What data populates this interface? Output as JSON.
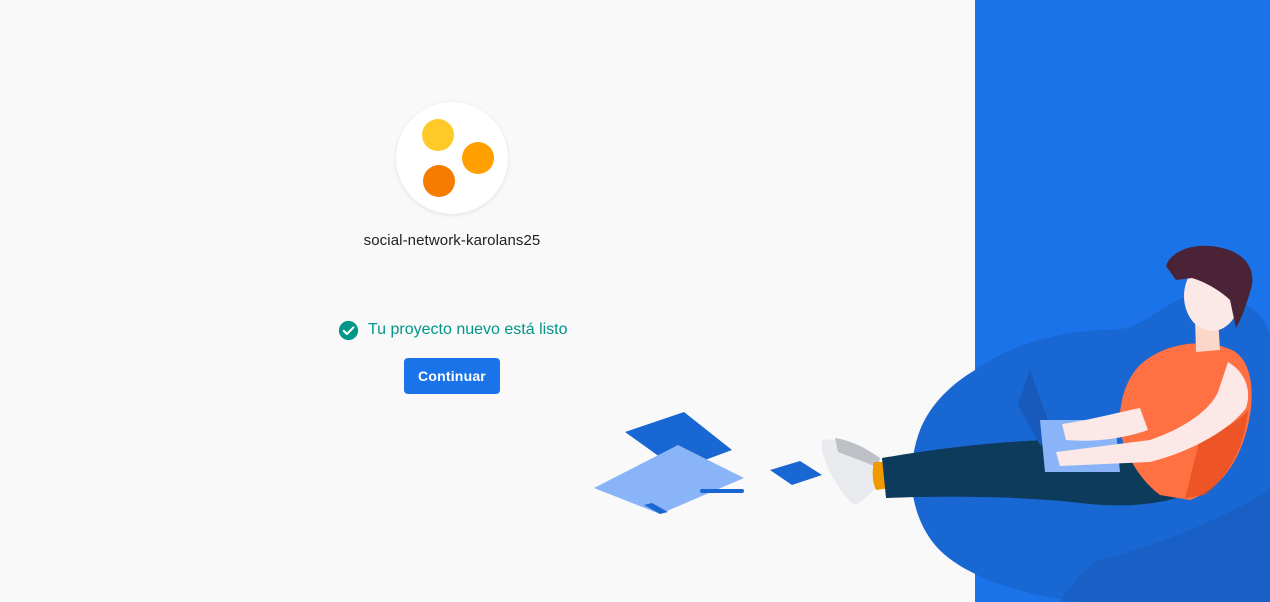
{
  "project": {
    "name": "social-network-karolans25",
    "avatar_colors": [
      "#ffca28",
      "#ffa000",
      "#f57c00"
    ]
  },
  "status": {
    "icon": "check-circle-icon",
    "text": "Tu proyecto nuevo está listo",
    "color": "#009688"
  },
  "actions": {
    "continue_label": "Continuar"
  },
  "theme": {
    "accent": "#1a73e8",
    "background": "#f9f9f9"
  }
}
